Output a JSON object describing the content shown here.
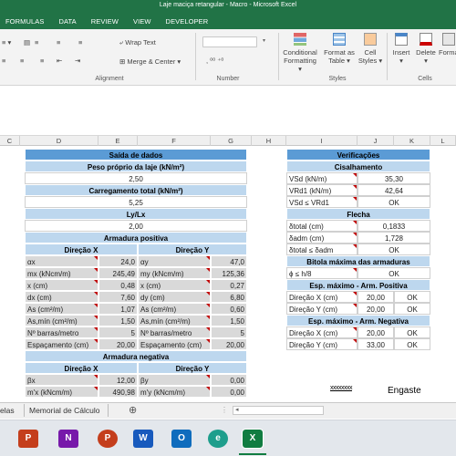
{
  "window": {
    "title": "Laje maciça retangular - Macro - Microsoft Excel"
  },
  "ribbon_tabs": [
    "FORMULAS",
    "DATA",
    "REVIEW",
    "VIEW",
    "DEVELOPER"
  ],
  "ribbon": {
    "wrap_text": "Wrap Text",
    "merge_center": "Merge & Center",
    "cond_fmt_1": "Conditional",
    "cond_fmt_2": "Formatting",
    "fmt_table_1": "Format as",
    "fmt_table_2": "Table",
    "cell_styles_1": "Cell",
    "cell_styles_2": "Styles",
    "insert": "Insert",
    "delete": "Delete",
    "format": "Format",
    "group_alignment": "Alignment",
    "group_number": "Number",
    "group_styles": "Styles",
    "group_cells": "Cells"
  },
  "columns": [
    "C",
    "D",
    "E",
    "F",
    "G",
    "H",
    "I",
    "J",
    "K",
    "L"
  ],
  "saida": {
    "title": "Saída de dados",
    "peso_label": "Peso próprio da laje (kN/m²)",
    "peso_value": "2,50",
    "carreg_label": "Carregamento total (kN/m²)",
    "carreg_value": "5,25",
    "lylx_label": "Ly/Lx",
    "lylx_value": "2,00",
    "arm_pos": "Armadura positiva",
    "dir_x": "Direção X",
    "dir_y": "Direção Y",
    "pos_rows": [
      {
        "a": "αx",
        "b": "24,0",
        "c": "αy",
        "d": "47,0"
      },
      {
        "a": "mx (kNcm/m)",
        "b": "245,49",
        "c": "my (kNcm/m)",
        "d": "125,36"
      },
      {
        "a": "x (cm)",
        "b": "0,48",
        "c": "x (cm)",
        "d": "0,27"
      },
      {
        "a": "dx (cm)",
        "b": "7,60",
        "c": "dy (cm)",
        "d": "6,80"
      },
      {
        "a": "As (cm²/m)",
        "b": "1,07",
        "c": "As (cm²/m)",
        "d": "0,60"
      },
      {
        "a": "As,mín (cm²/m)",
        "b": "1,50",
        "c": "As,mín (cm²/m)",
        "d": "1,50"
      },
      {
        "a": "Nº barras/metro",
        "b": "5",
        "c": "Nº barras/metro",
        "d": "5"
      },
      {
        "a": "Espaçamento (cm)",
        "b": "20,00",
        "c": "Espaçamento (cm)",
        "d": "20,00"
      }
    ],
    "arm_neg": "Armadura negativa",
    "dir_x2": "Direção X",
    "dir_y2": "Direção Y",
    "neg_rows": [
      {
        "a": "βx",
        "b": "12,00",
        "c": "βy",
        "d": "0,00"
      },
      {
        "a": "m'x (kNcm/m)",
        "b": "490,98",
        "c": "m'y (kNcm/m)",
        "d": "0,00"
      }
    ]
  },
  "verif": {
    "title": "Verificações",
    "cis": "Cisalhamento",
    "cis_rows": [
      {
        "a": "VSd (kN/m)",
        "b": "35,30"
      },
      {
        "a": "VRd1 (kN/m)",
        "b": "42,64"
      },
      {
        "a": "VSd ≤ VRd1",
        "b": "OK"
      }
    ],
    "flecha": "Flecha",
    "fl_rows": [
      {
        "a": "δtotal (cm)",
        "b": "0,1833"
      },
      {
        "a": "δadm (cm)",
        "b": "1,728"
      },
      {
        "a": "δtotal ≤ δadm",
        "b": "OK"
      }
    ],
    "bitola": "Bitola máxima das armaduras",
    "bit_row": {
      "a": "ϕ ≤ h/8",
      "b": "OK"
    },
    "esp_pos": "Esp. máximo - Arm. Positiva",
    "pos_rows": [
      {
        "a": "Direção X (cm)",
        "b": "20,00",
        "c": "OK"
      },
      {
        "a": "Direção Y (cm)",
        "b": "20,00",
        "c": "OK"
      }
    ],
    "esp_neg": "Esp. máximo - Arm. Negativa",
    "neg_rows": [
      {
        "a": "Direção X (cm)",
        "b": "20,00",
        "c": "OK"
      },
      {
        "a": "Direção Y (cm)",
        "b": "33,00",
        "c": "OK"
      }
    ]
  },
  "legend": {
    "engaste": "Engaste",
    "xmark": "xxxxxxxx"
  },
  "sheets": {
    "s1": "elas",
    "s2": "Memorial de Cálculo",
    "add": "⊕"
  },
  "taskbar": [
    "PowerPoint",
    "OneNote",
    "Word",
    "Outlook",
    "Edge",
    "Excel"
  ]
}
